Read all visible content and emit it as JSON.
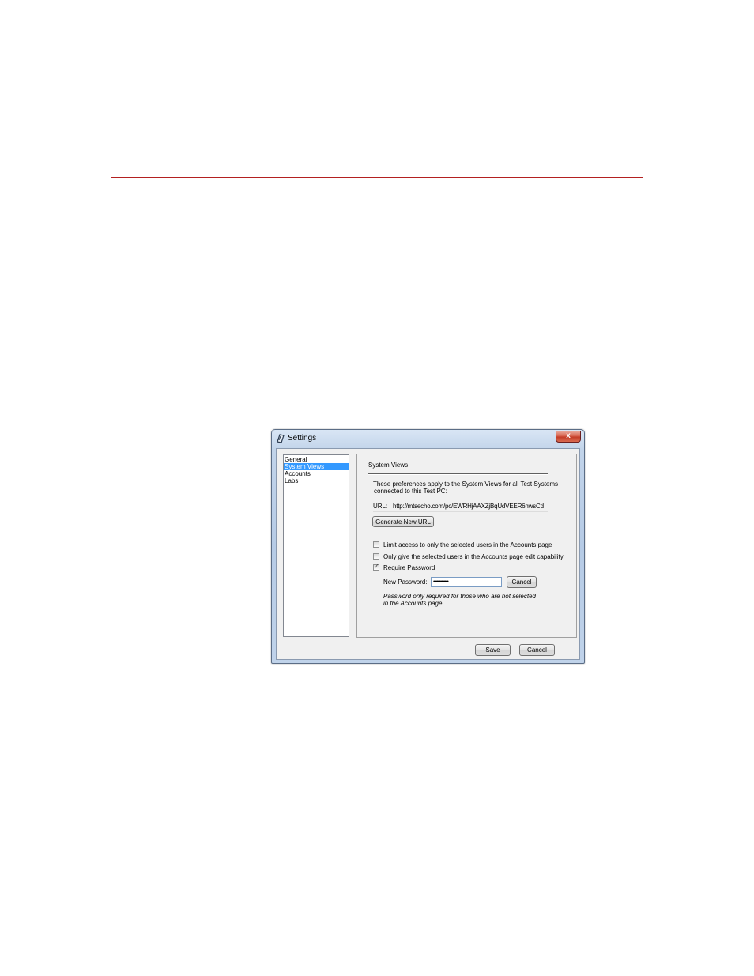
{
  "window": {
    "title": "Settings",
    "close_label": "x"
  },
  "nav": {
    "items": [
      "General",
      "System Views",
      "Accounts",
      "Labs"
    ],
    "selected": 1
  },
  "panel": {
    "title": "System Views",
    "description_line1": "These preferences apply to the System Views for all Test Systems",
    "description_line2": "connected to this Test PC:",
    "url_label": "URL:",
    "url_value": "http://mtsecho.com/pc/EWRHjAAXZjBqUdVEER6nwsCd",
    "generate_button": "Generate New URL",
    "options": [
      {
        "label": "Limit access to only the selected users in the Accounts page",
        "checked": false
      },
      {
        "label": "Only give the selected users in the Accounts page edit capability",
        "checked": false
      },
      {
        "label": "Require Password",
        "checked": true
      }
    ],
    "password_label": "New Password:",
    "password_value": "•••••••••••••",
    "password_cancel": "Cancel",
    "note_line1": "Password only required for those who are not selected",
    "note_line2": "in the Accounts page."
  },
  "footer": {
    "save_label": "Save",
    "cancel_label": "Cancel"
  },
  "colors": {
    "rule": "#b32020",
    "selection": "#3399ff",
    "close_button": "#c9402b"
  }
}
